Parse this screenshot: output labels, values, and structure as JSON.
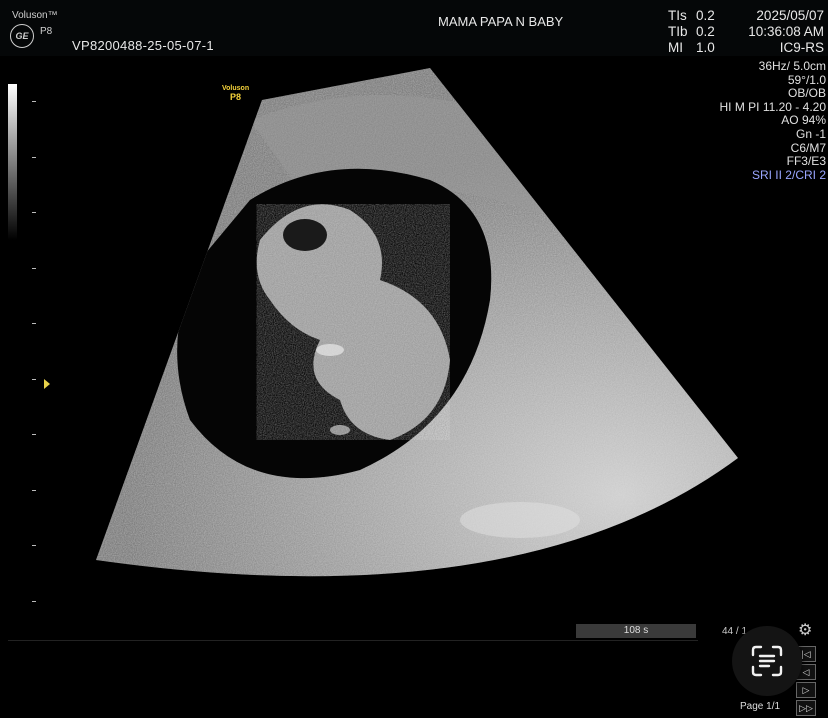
{
  "header": {
    "brand": "Voluson™",
    "logo_text": "GE",
    "probe_short": "P8",
    "exam_id": "VP8200488-25-05-07-1",
    "patient_name": "MAMA PAPA N BABY",
    "tis_label": "TIs",
    "tis_value": "0.2",
    "tib_label": "TIb",
    "tib_value": "0.2",
    "mi_label": "MI",
    "mi_value": "1.0",
    "date": "2025/05/07",
    "time": "10:36:08 AM",
    "probe": "IC9-RS"
  },
  "params": {
    "line1": "36Hz/ 5.0cm",
    "line2": "59°/1.0",
    "line3": "OB/OB",
    "line4": "HI M PI 11.20 - 4.20",
    "line5": "AO 94%",
    "line6": "Gn  -1",
    "line7": "C6/M7",
    "line8": "FF3/E3",
    "line9": "SRI II 2/CRI 2"
  },
  "image_tag": {
    "brand": "Voluson",
    "model": "P8"
  },
  "footer": {
    "cine_length": "108 s",
    "frame_count": "44 / 1",
    "page": "Page 1/1"
  },
  "icons": {
    "settings": "gear-icon",
    "scan_text": "text-scan-icon"
  },
  "colors": {
    "focus_marker": "#e8d24a",
    "highlight_param": "#9aa6ff",
    "image_tag": "#f5d23a"
  }
}
